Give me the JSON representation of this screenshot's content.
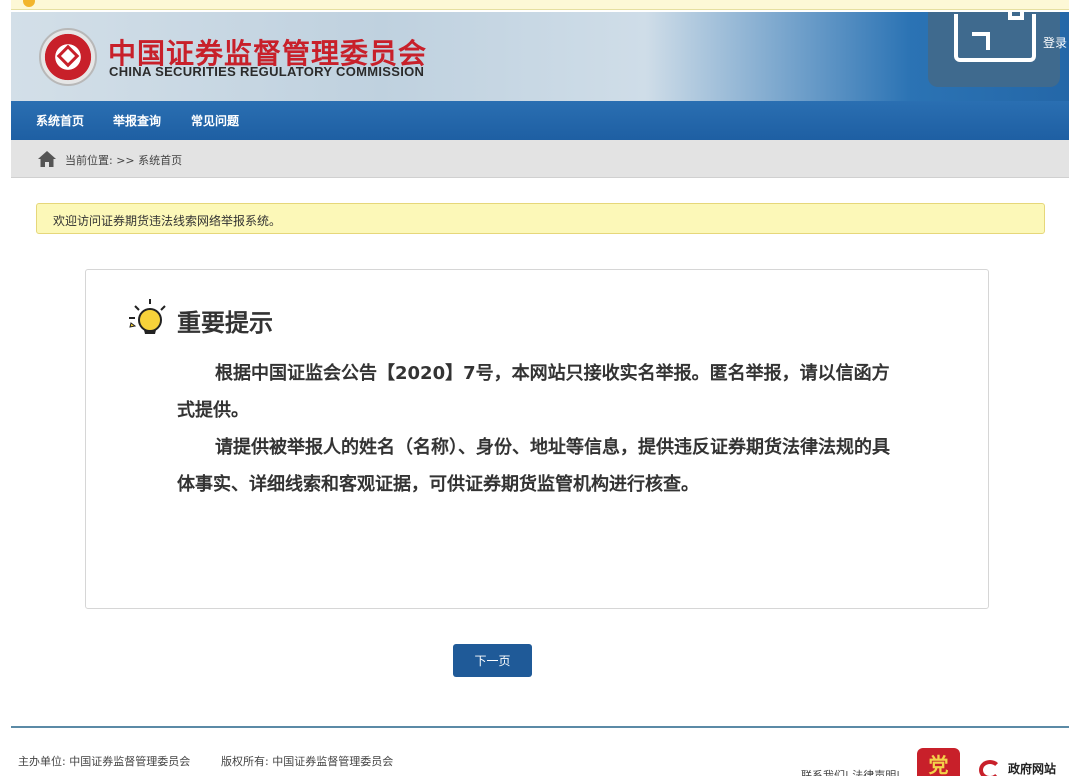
{
  "header": {
    "org_cn": "中国证券监督管理委员会",
    "org_en": "CHINA SECURITIES REGULATORY COMMISSION",
    "login_label": "登录"
  },
  "nav": {
    "items": [
      {
        "label": "系统首页"
      },
      {
        "label": "举报查询"
      },
      {
        "label": "常见问题"
      }
    ]
  },
  "breadcrumb": {
    "prefix": "当前位置:",
    "separator": ">>",
    "current": "系统首页"
  },
  "notice": {
    "text": "欢迎访问证券期货违法线索网络举报系统。"
  },
  "notice_card": {
    "title": "重要提示",
    "paragraph_1": "根据中国证监会公告【2020】7号，本网站只接收实名举报。匿名举报，请以信函方式提供。",
    "paragraph_2": "请提供被举报人的姓名（名称）、身份、地址等信息，提供违反证券期货法律法规的具体事实、详细线索和客观证据，可供证券期货监管机构进行核查。"
  },
  "next_button": {
    "label": "下一页"
  },
  "footer": {
    "host_label": "主办单位:",
    "host_value": "中国证券监督管理委员会",
    "copyright_label": "版权所有:",
    "copyright_value": "中国证券监督管理委员会",
    "contact_links": "联系我们| 法律声明|",
    "gov_site_label": "政府网站",
    "party_badge_char": "党"
  },
  "colors": {
    "nav_blue": "#1e5fa3",
    "accent_red": "#c8202a",
    "notice_yellow": "#fcf8b8",
    "button_blue": "#1f5a98"
  }
}
